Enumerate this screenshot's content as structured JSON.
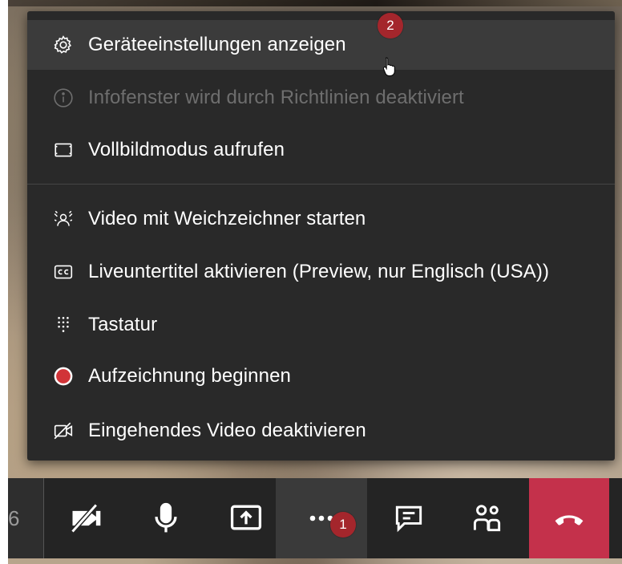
{
  "menu": {
    "items": [
      {
        "label": "Geräteeinstellungen anzeigen",
        "icon": "gear-icon",
        "state": "hover"
      },
      {
        "label": "Infofenster wird durch Richtlinien deaktiviert",
        "icon": "info-icon",
        "state": "disabled"
      },
      {
        "label": "Vollbildmodus aufrufen",
        "icon": "fullscreen-icon",
        "state": "normal"
      },
      {
        "label": "Video mit Weichzeichner starten",
        "icon": "blur-background-icon",
        "state": "normal"
      },
      {
        "label": "Liveuntertitel aktivieren (Preview, nur Englisch (USA))",
        "icon": "closed-captions-icon",
        "state": "normal"
      },
      {
        "label": "Tastatur",
        "icon": "dialpad-icon",
        "state": "normal"
      },
      {
        "label": "Aufzeichnung beginnen",
        "icon": "record-icon",
        "state": "normal"
      },
      {
        "label": "Eingehendes Video deaktivieren",
        "icon": "video-off-icon",
        "state": "normal"
      }
    ]
  },
  "annotations": {
    "step1": "1",
    "step2": "2"
  },
  "toolbar": {
    "left_stub_text": "6",
    "buttons": [
      "camera-off-icon",
      "microphone-icon",
      "share-screen-icon",
      "more-options-icon",
      "chat-icon",
      "participants-icon",
      "hang-up-icon"
    ]
  },
  "colors": {
    "menu_bg": "#292929",
    "hover_bg": "#3b3b3b",
    "disabled_text": "#6e6e6e",
    "badge": "#a4262c",
    "hangup": "#c4314b",
    "record_red": "#d13438"
  }
}
